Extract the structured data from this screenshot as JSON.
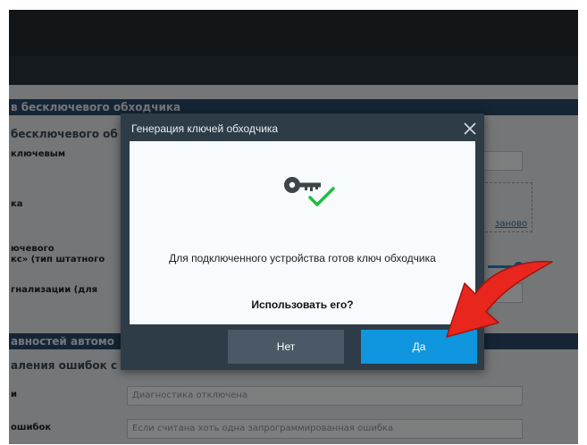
{
  "background": {
    "section1_title": "в бесключевого обходчика",
    "section1_sub": "бесключевого об",
    "rows": [
      {
        "label": "ключевым",
        "value": ""
      },
      {
        "label": "ка",
        "value": ""
      },
      {
        "label": "ючевого\nкс» (тип штатного",
        "value": ""
      },
      {
        "label": "гнализации (для",
        "value": ""
      }
    ],
    "link_text": "заново",
    "section2_title": "авностей автомо",
    "section2_sub": "аления ошибок с",
    "rows2": [
      {
        "label": "и",
        "value": "Диагностика отключена"
      },
      {
        "label": "ошибок",
        "value": "Если считана хоть одна запрограммированная ошибка"
      }
    ]
  },
  "dialog": {
    "title": "Генерация ключей обходчика",
    "message": "Для подключенного устройства готов ключ обходчика",
    "question": "Использовать его?",
    "no_label": "Нет",
    "yes_label": "Да"
  },
  "colors": {
    "accent": "#0f96df",
    "dialog_bg": "#2e3c48",
    "check": "#1fbf3a",
    "arrow": "#e8261d"
  },
  "icons": [
    "key-icon",
    "checkmark-icon",
    "close-icon",
    "red-arrow-icon"
  ]
}
